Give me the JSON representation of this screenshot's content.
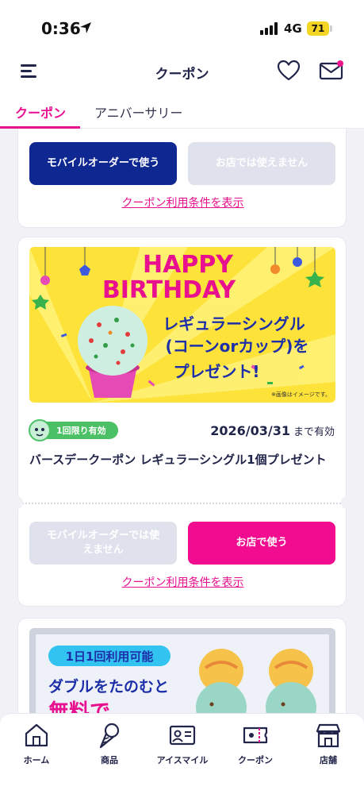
{
  "status_bar": {
    "time": "0:36",
    "network": "4G",
    "battery": "71"
  },
  "header": {
    "title": "クーポン"
  },
  "tabs": [
    {
      "label": "クーポン",
      "active": true
    },
    {
      "label": "アニバーサリー",
      "active": false
    }
  ],
  "cards": [
    {
      "mobile_order_label": "モバイルオーダーで使う",
      "store_label": "お店では使えません",
      "terms_label": "クーポン利用条件を表示"
    },
    {
      "banner": {
        "line1": "HAPPY",
        "line2": "BIRTHDAY",
        "line3": "レギュラーシングル",
        "line4": "(コーンorカップ)を",
        "line5": "プレゼント!",
        "note": "※画像はイメージです。"
      },
      "badge": "1回限り有効",
      "expiry_date": "2026/03/31",
      "expiry_suffix": "まで有効",
      "title": "バースデークーポン レギュラーシングル1個プレゼント",
      "mobile_order_label": "モバイルオーダーでは使えません",
      "store_label": "お店で使う",
      "terms_label": "クーポン利用条件を表示"
    },
    {
      "banner": {
        "pill": "1日1回利用可能",
        "line1": "ダブルをたのむと",
        "line2": "無料で"
      }
    }
  ],
  "bottom_nav": [
    {
      "label": "ホーム",
      "icon": "home-icon"
    },
    {
      "label": "商品",
      "icon": "ice-cream-cone-icon"
    },
    {
      "label": "アイスマイル",
      "icon": "member-card-icon"
    },
    {
      "label": "クーポン",
      "icon": "coupon-ticket-icon"
    },
    {
      "label": "店舗",
      "icon": "store-icon"
    }
  ],
  "colors": {
    "accent": "#e8108f",
    "navy": "#0f2891",
    "disabled": "#dfe1ec",
    "badge_green": "#4cc064"
  }
}
